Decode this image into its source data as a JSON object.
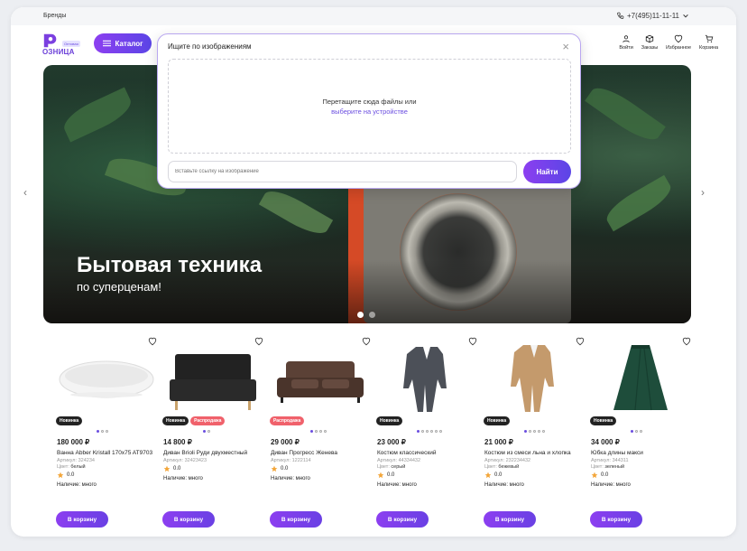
{
  "topbar": {
    "brands": "Бренды",
    "phone": "+7(495)11-11-11"
  },
  "logo": {
    "word": "ОЗНИЦА",
    "badge": "Оптовая"
  },
  "header": {
    "catalog_label": "Каталог",
    "icons": [
      {
        "label": "Войти",
        "icon": "user-icon"
      },
      {
        "label": "Заказы",
        "icon": "box-icon"
      },
      {
        "label": "Избранное",
        "icon": "heart-icon"
      },
      {
        "label": "Корзина",
        "icon": "cart-icon"
      }
    ]
  },
  "modal": {
    "title": "Ищите по изображениям",
    "drop_text": "Перетащите сюда файлы или",
    "drop_link": "выберите на устройстве",
    "url_placeholder": "Вставьте ссылку на изображение",
    "find_label": "Найти"
  },
  "hero": {
    "title": "Бытовая техника",
    "subtitle": "по суперценам!",
    "slides": 2,
    "active_slide": 1
  },
  "products": [
    {
      "price": "180 000 ₽",
      "name": "Ванна Abber Kristall 170x75 AT9703",
      "sku_label": "Артикул:",
      "sku": "324234",
      "color_label": "Цвет:",
      "color": "белый",
      "rating": "0.0",
      "availability": "Наличие: много",
      "badges": [
        {
          "text": "Новинка",
          "kind": "new"
        }
      ],
      "images": 3,
      "cart_label": "В корзину",
      "image_kind": "bathtub"
    },
    {
      "price": "14 800 ₽",
      "name": "Диван Brioli Руди двухместный",
      "sku_label": "Артикул:",
      "sku": "32423423",
      "color_label": "",
      "color": "",
      "rating": "0.0",
      "availability": "Наличие: много",
      "badges": [
        {
          "text": "Новинка",
          "kind": "new"
        },
        {
          "text": "Распродажа",
          "kind": "sale"
        }
      ],
      "images": 2,
      "cart_label": "В корзину",
      "image_kind": "sofa-black"
    },
    {
      "price": "29 000 ₽",
      "name": "Диван Прогресс Женева",
      "sku_label": "Артикул:",
      "sku": "1222114",
      "color_label": "",
      "color": "",
      "rating": "0.0",
      "availability": "Наличие: много",
      "badges": [
        {
          "text": "Распродажа",
          "kind": "sale"
        }
      ],
      "images": 4,
      "cart_label": "В корзину",
      "image_kind": "sofa-brown"
    },
    {
      "price": "23 000 ₽",
      "name": "Костюм классический",
      "sku_label": "Артикул:",
      "sku": "44334432",
      "color_label": "Цвет:",
      "color": "серый",
      "rating": "0.0",
      "availability": "Наличие: много",
      "badges": [
        {
          "text": "Новинка",
          "kind": "new"
        }
      ],
      "images": 6,
      "cart_label": "В корзину",
      "image_kind": "suit-grey"
    },
    {
      "price": "21 000 ₽",
      "name": "Костюм из смеси льна и хлопка",
      "sku_label": "Артикул:",
      "sku": "232234432",
      "color_label": "Цвет:",
      "color": "бежевый",
      "rating": "0.0",
      "availability": "Наличие: много",
      "badges": [
        {
          "text": "Новинка",
          "kind": "new"
        }
      ],
      "images": 5,
      "cart_label": "В корзину",
      "image_kind": "suit-beige"
    },
    {
      "price": "34 000 ₽",
      "name": "Юбка длины макси",
      "sku_label": "Артикул:",
      "sku": "344311",
      "color_label": "Цвет:",
      "color": "зеленый",
      "rating": "0.0",
      "availability": "Наличие: много",
      "badges": [
        {
          "text": "Новинка",
          "kind": "new"
        }
      ],
      "images": 3,
      "cart_label": "В корзину",
      "image_kind": "skirt-green"
    }
  ],
  "colors": {
    "accent": "#6b4ee0",
    "accent_start": "#8c3ff0",
    "sale": "#f0616b",
    "hero_orange": "#d54a26"
  }
}
